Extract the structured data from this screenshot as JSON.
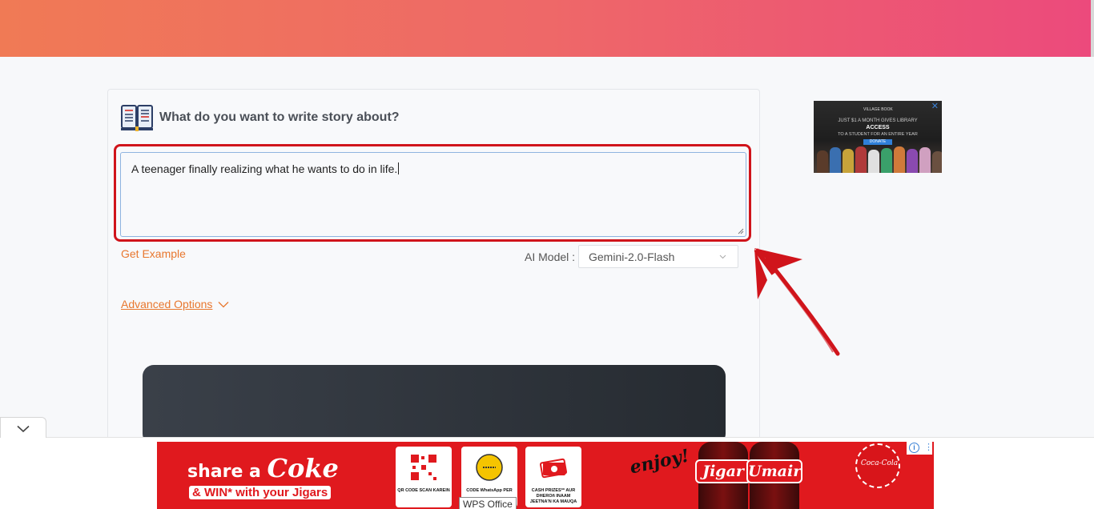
{
  "header": {
    "gradient": [
      "#f07a55",
      "#ee6868",
      "#ec4a7c"
    ]
  },
  "form": {
    "prompt_title": "What do you want to write story about?",
    "story_text": "A teenager finally realizing what he wants to do in life.",
    "get_example_label": "Get Example",
    "ai_model_label": "AI Model :",
    "ai_model_value": "Gemini-2.0-Flash",
    "advanced_options_label": "Advanced Options",
    "accent_color": "#e8772e",
    "highlight_color": "#d0141b"
  },
  "side_ad": {
    "brand": "VILLAGE BOOK",
    "line1": "JUST $1 A MONTH GIVES LIBRARY",
    "line2": "ACCESS",
    "line3": "TO A STUDENT FOR AN ENTIRE YEAR",
    "donate": "DONATE",
    "close": "✕"
  },
  "bottom_ad": {
    "headline_a": "share a ",
    "headline_b": "Coke",
    "win_line": "& WIN* with your Jigars",
    "tiles": [
      {
        "text": "QR CODE SCAN KAREIN",
        "icon": "qr-code-icon"
      },
      {
        "text": "CODE WhatsApp PER",
        "icon": "code-coin-icon"
      },
      {
        "text": "CASH PRIZES** AUR DHEROñ INAAM JEETNA'N KA MAUQA",
        "icon": "cash-icon"
      }
    ],
    "enjoy": "enjoy!",
    "bottle_names": [
      "Jigar",
      "Umair"
    ],
    "badge_text": "Coca-Cola"
  },
  "tooltip": {
    "text": "WPS Office"
  }
}
